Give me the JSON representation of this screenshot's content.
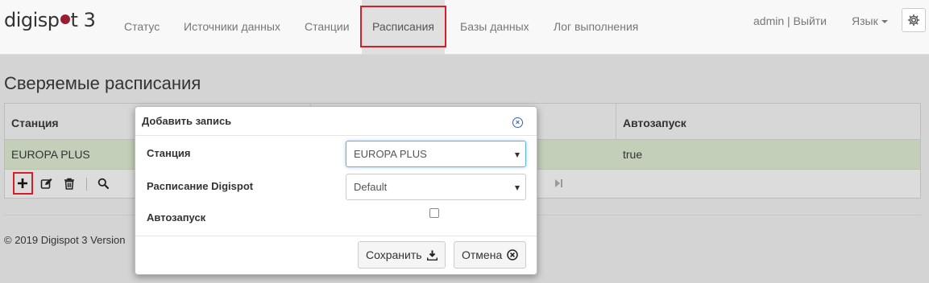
{
  "brand": {
    "name_left": "digisp",
    "name_right": "t 3"
  },
  "nav": {
    "items": [
      {
        "label": "Статус"
      },
      {
        "label": "Источники данных"
      },
      {
        "label": "Станции"
      },
      {
        "label": "Расписания"
      },
      {
        "label": "Базы данных"
      },
      {
        "label": "Лог выполнения"
      }
    ],
    "active_index": 3,
    "user": "admin | Выйти",
    "language": "Язык",
    "settings_icon": "gear-icon"
  },
  "page": {
    "title": "Сверяемые расписания",
    "footer": "© 2019 Digispot 3 Version"
  },
  "grid": {
    "columns": [
      "Станция",
      "",
      "Автозапуск"
    ],
    "rows": [
      {
        "station": "EUROPA PLUS",
        "autostart": "true"
      }
    ],
    "toolbar_icons": [
      "plus-icon",
      "edit-icon",
      "trash-icon",
      "search-icon"
    ]
  },
  "modal": {
    "title": "Добавить запись",
    "fields": {
      "station_label": "Станция",
      "station_value": "EUROPA PLUS",
      "schedule_label": "Расписание Digispot",
      "schedule_value": "Default",
      "autostart_label": "Автозапуск",
      "autostart_checked": false
    },
    "save_label": "Сохранить",
    "cancel_label": "Отмена"
  },
  "colors": {
    "brand_dot": "#9b1b30",
    "highlight": "#d41f26",
    "row_selected": "#c3cfb9",
    "close_icon": "#3b5ea8"
  }
}
